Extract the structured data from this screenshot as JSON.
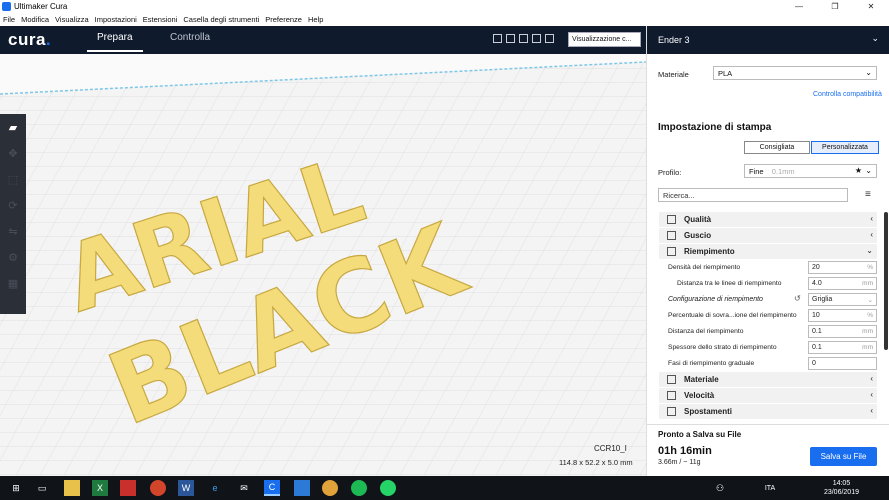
{
  "window": {
    "title": "Ultimaker Cura",
    "minimize": "—",
    "maximize": "❐",
    "close": "✕"
  },
  "menu": [
    "File",
    "Modifica",
    "Visualizza",
    "Impostazioni",
    "Estensioni",
    "Casella degli strumenti",
    "Preferenze",
    "Help"
  ],
  "header": {
    "logo": "cura",
    "logo_dot": ".",
    "tabs": {
      "prepara": "Prepara",
      "controlla": "Controlla"
    },
    "view_select": "Visualizzazione c..."
  },
  "viewport": {
    "model_text_line1": "ARIAL",
    "model_text_line2": "BLACK",
    "object_name": "CCR10_I",
    "object_dims": "114.8 x 52.2 x 5.0 mm"
  },
  "panel": {
    "printer": "Ender 3",
    "material_label": "Materiale",
    "material_value": "PLA",
    "compat_link": "Controlla compatibilità",
    "settings_title": "Impostazione di stampa",
    "toggle_recommended": "Consigliata",
    "toggle_custom": "Personalizzata",
    "profile_label": "Profilo:",
    "profile_value": "Fine",
    "profile_hint": "0.1mm",
    "search_placeholder": "Ricerca...",
    "categories": {
      "quality": "Qualità",
      "shell": "Guscio",
      "infill": "Riempimento",
      "material": "Materiale",
      "speed": "Velocità",
      "travel": "Spostamenti"
    },
    "infill_settings": [
      {
        "label": "Densità del riempimento",
        "value": "20",
        "unit": "%"
      },
      {
        "label": "Distanza tra le linee di riempimento",
        "value": "4.0",
        "unit": "mm"
      },
      {
        "label": "Configurazione di riempimento",
        "value": "Griglia",
        "unit": ""
      },
      {
        "label": "Percentuale di sovra...ione del riempimento",
        "value": "10",
        "unit": "%"
      },
      {
        "label": "Distanza del riempimento",
        "value": "0.1",
        "unit": "mm"
      },
      {
        "label": "Spessore dello strato di riempimento",
        "value": "0.1",
        "unit": "mm"
      },
      {
        "label": "Fasi di riempimento graduale",
        "value": "0",
        "unit": ""
      }
    ],
    "status": {
      "ready": "Pronto a Salva su File",
      "time": "01h 16min",
      "material_usage": "3.66m / ~ 11g",
      "save_button": "Salva su File"
    }
  },
  "taskbar": {
    "time": "14:05",
    "date": "23/06/2019",
    "lang": "ITA"
  }
}
